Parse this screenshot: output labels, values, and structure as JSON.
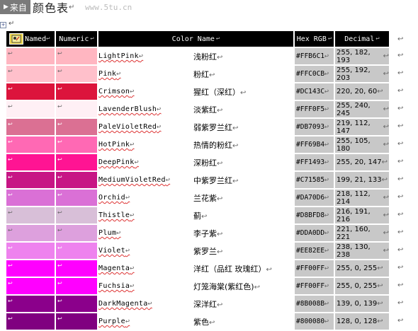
{
  "title": {
    "chip": "来自",
    "heading": "颜色表",
    "watermark": "www.5tu.cn"
  },
  "marks": {
    "para": "↵",
    "cell": "↩"
  },
  "columns": [
    "Named",
    "Numeric",
    "Color Name",
    "Hex RGB",
    "Decimal"
  ],
  "rows": [
    {
      "name": "LightPink",
      "cn": "浅粉红",
      "hex": "#FFB6C1",
      "dec": "255, 182, 193",
      "color": "#FFB6C1",
      "light": true
    },
    {
      "name": "Pink",
      "cn": "粉红",
      "hex": "#FFC0CB",
      "dec": "255, 192, 203",
      "color": "#FFC0CB",
      "light": true
    },
    {
      "name": "Crimson",
      "cn": "猩红（深红）",
      "hex": "#DC143C",
      "dec": "220, 20, 60",
      "color": "#DC143C",
      "light": false
    },
    {
      "name": "LavenderBlush",
      "cn": "淡紫红",
      "hex": "#FFF0F5",
      "dec": "255, 240, 245",
      "color": "#FFF0F5",
      "light": true
    },
    {
      "name": "PaleVioletRed",
      "cn": "弱紫罗兰红",
      "hex": "#DB7093",
      "dec": "219, 112, 147",
      "color": "#DB7093",
      "light": false
    },
    {
      "name": "HotPink",
      "cn": "热情的粉红",
      "hex": "#FF69B4",
      "dec": "255, 105, 180",
      "color": "#FF69B4",
      "light": false
    },
    {
      "name": "DeepPink",
      "cn": "深粉红",
      "hex": "#FF1493",
      "dec": "255, 20, 147",
      "color": "#FF1493",
      "light": false
    },
    {
      "name": "MediumVioletRed",
      "cn": "中紫罗兰红",
      "hex": "#C71585",
      "dec": "199, 21, 133",
      "color": "#C71585",
      "light": false
    },
    {
      "name": "Orchid",
      "cn": "兰花紫",
      "hex": "#DA70D6",
      "dec": "218, 112, 214",
      "color": "#DA70D6",
      "light": false
    },
    {
      "name": "Thistle",
      "cn": "蓟",
      "hex": "#D8BFD8",
      "dec": "216, 191, 216",
      "color": "#D8BFD8",
      "light": true
    },
    {
      "name": "Plum",
      "cn": "李子紫",
      "hex": "#DDA0DD",
      "dec": "221, 160, 221",
      "color": "#DDA0DD",
      "light": true
    },
    {
      "name": "Violet",
      "cn": "紫罗兰",
      "hex": "#EE82EE",
      "dec": "238, 130, 238",
      "color": "#EE82EE",
      "light": false
    },
    {
      "name": "Magenta",
      "cn": "洋红（品红 玫瑰红）",
      "hex": "#FF00FF",
      "dec": "255, 0, 255",
      "color": "#FF00FF",
      "light": false
    },
    {
      "name": "Fuchsia",
      "cn": "灯笼海棠(紫红色)",
      "hex": "#FF00FF",
      "dec": "255, 0, 255",
      "color": "#FF00FF",
      "light": false
    },
    {
      "name": "DarkMagenta",
      "cn": "深洋红",
      "hex": "#8B008B",
      "dec": "139, 0, 139",
      "color": "#8B008B",
      "light": false
    },
    {
      "name": "Purple",
      "cn": "紫色",
      "hex": "#800080",
      "dec": "128, 0, 128",
      "color": "#800080",
      "light": false
    }
  ]
}
